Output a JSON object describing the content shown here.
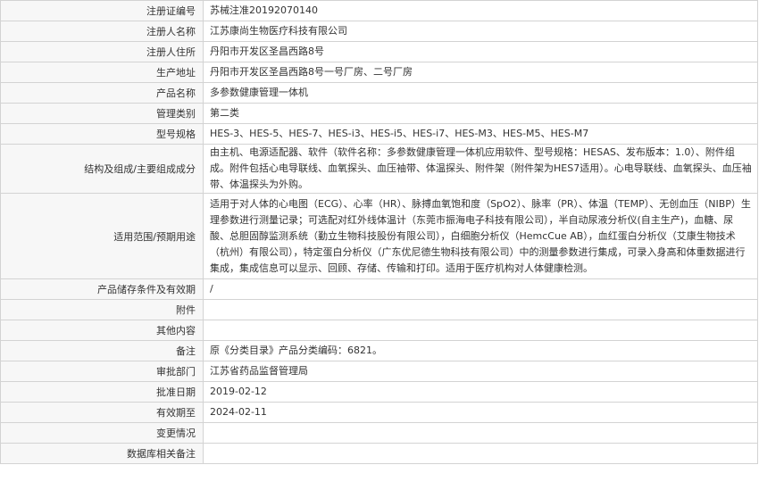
{
  "rows": [
    {
      "label": "注册证编号",
      "value": "苏械注准20192070140"
    },
    {
      "label": "注册人名称",
      "value": "江苏康尚生物医疗科技有限公司"
    },
    {
      "label": "注册人住所",
      "value": "丹阳市开发区圣昌西路8号"
    },
    {
      "label": "生产地址",
      "value": "丹阳市开发区圣昌西路8号一号厂房、二号厂房"
    },
    {
      "label": "产品名称",
      "value": "多参数健康管理一体机"
    },
    {
      "label": "管理类别",
      "value": "第二类"
    },
    {
      "label": "型号规格",
      "value": "HES-3、HES-5、HES-7、HES-i3、HES-i5、HES-i7、HES-M3、HES-M5、HES-M7"
    },
    {
      "label": "结构及组成/主要组成成分",
      "value": "由主机、电源适配器、软件（软件名称：多参数健康管理一体机应用软件、型号规格：HESAS、发布版本：1.0）、附件组成。附件包括心电导联线、血氧探头、血压袖带、体温探头、附件架（附件架为HES7适用）。心电导联线、血氧探头、血压袖带、体温探头为外购。"
    },
    {
      "label": "适用范围/预期用途",
      "value": "适用于对人体的心电图（ECG）、心率（HR）、脉搏血氧饱和度（SpO2）、脉率（PR）、体温（TEMP）、无创血压（NIBP）生理参数进行测量记录；可选配对红外线体温计（东莞市振海电子科技有限公司），半自动尿液分析仪(自主生产)，血糖、尿酸、总胆固醇监测系统（勤立生物科技股份有限公司），白细胞分析仪（HemcCue AB），血红蛋白分析仪（艾康生物技术（杭州）有限公司），特定蛋白分析仪（广东优尼德生物科技有限公司）中的测量参数进行集成，可录入身高和体重数据进行集成，集成信息可以显示、回顾、存储、传输和打印。适用于医疗机构对人体健康检测。"
    },
    {
      "label": "产品储存条件及有效期",
      "value": "/"
    },
    {
      "label": "附件",
      "value": ""
    },
    {
      "label": "其他内容",
      "value": ""
    },
    {
      "label": "备注",
      "value": "原《分类目录》产品分类编码：6821。"
    },
    {
      "label": "审批部门",
      "value": "江苏省药品监督管理局"
    },
    {
      "label": "批准日期",
      "value": "2019-02-12"
    },
    {
      "label": "有效期至",
      "value": "2024-02-11"
    },
    {
      "label": "变更情况",
      "value": ""
    },
    {
      "label": "数据库相关备注",
      "value": ""
    }
  ]
}
